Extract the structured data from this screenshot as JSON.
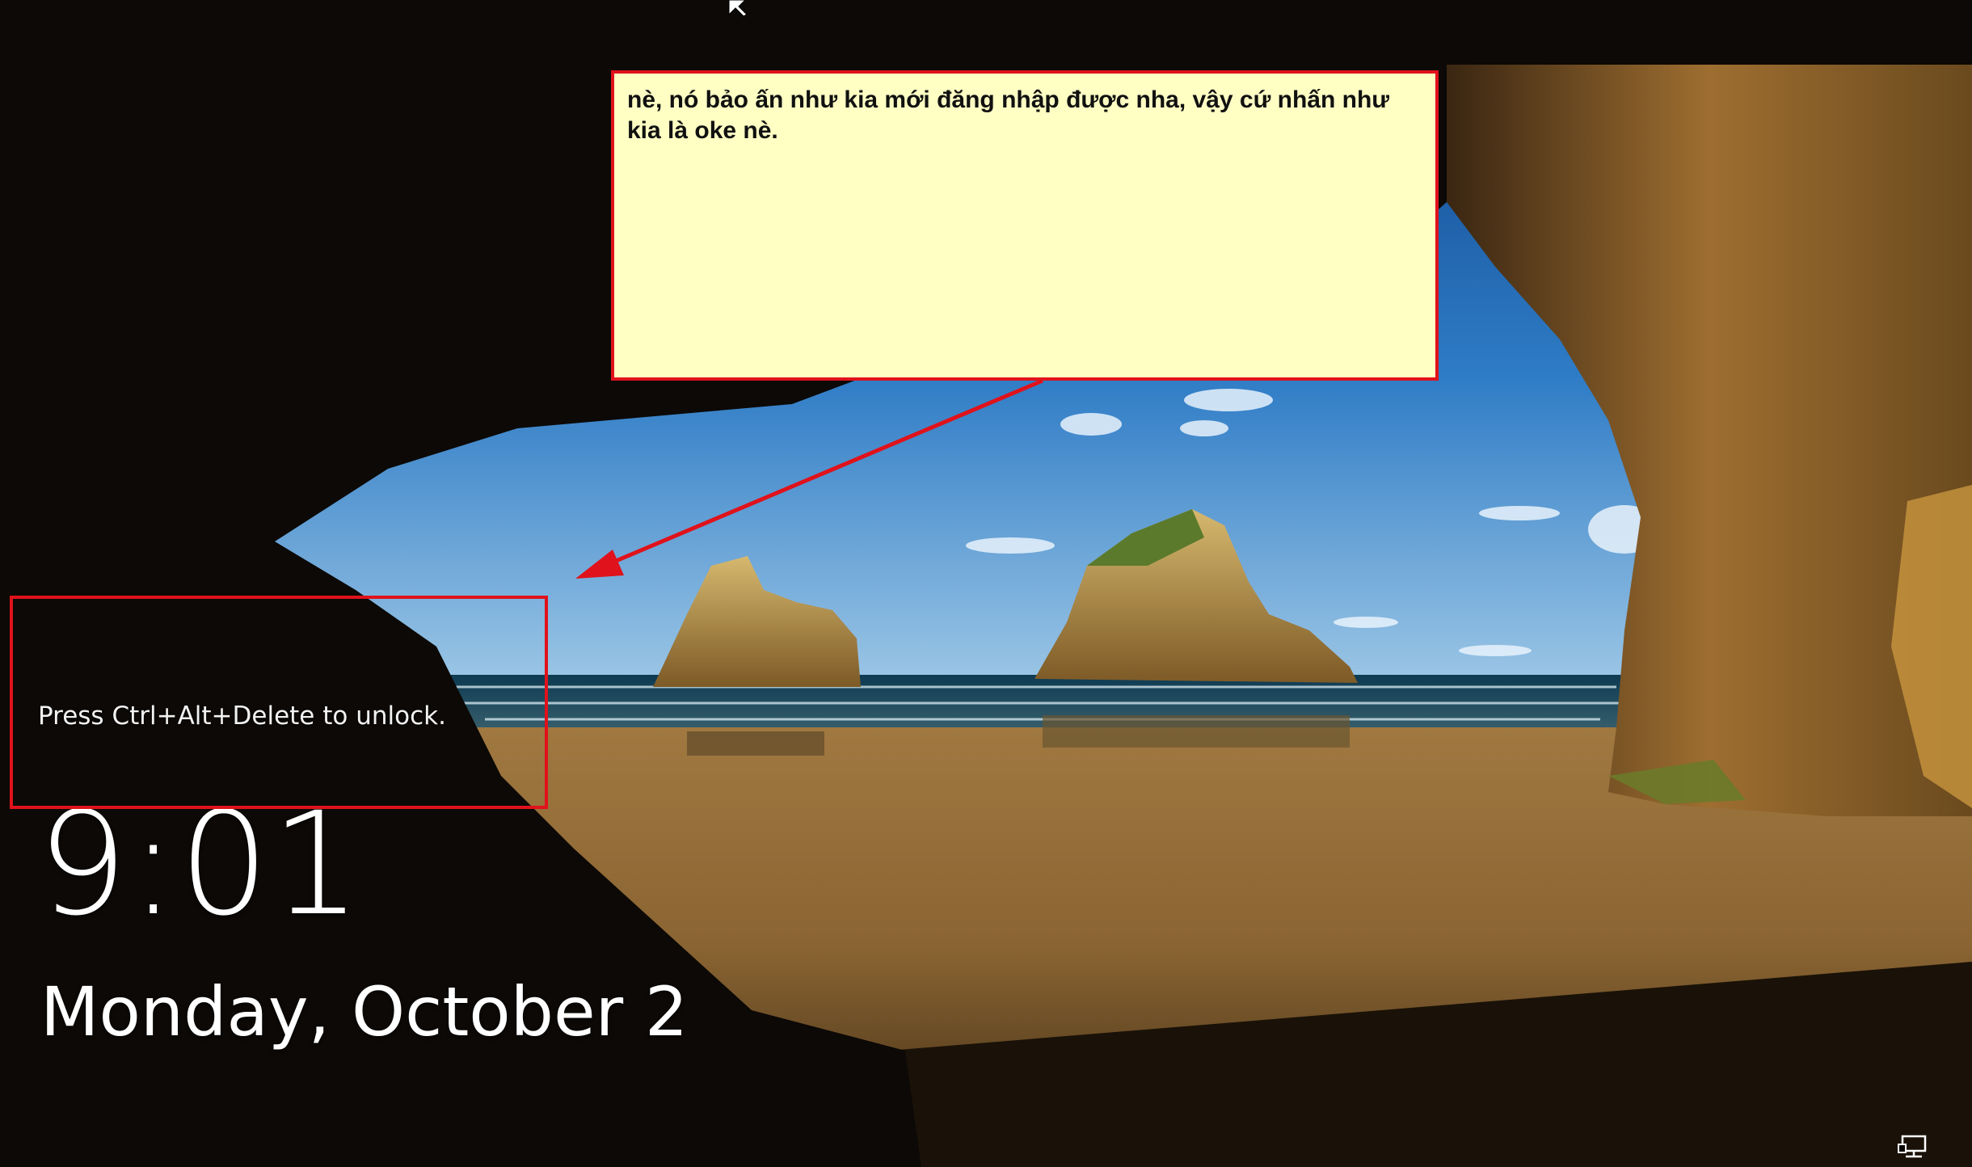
{
  "lock_screen": {
    "unlock_hint": "Press Ctrl+Alt+Delete to unlock.",
    "time": "9:01",
    "date": "Monday, October 2"
  },
  "annotation": {
    "note_text": "nè, nó bảo ấn như kia mới đăng nhập được nha, vậy cứ nhấn như kia là oke nè.",
    "border_color": "#e0121b",
    "note_background": "#ffffc4"
  },
  "icons": {
    "tray": "network-icon",
    "pointer": "mouse-cursor-icon"
  }
}
